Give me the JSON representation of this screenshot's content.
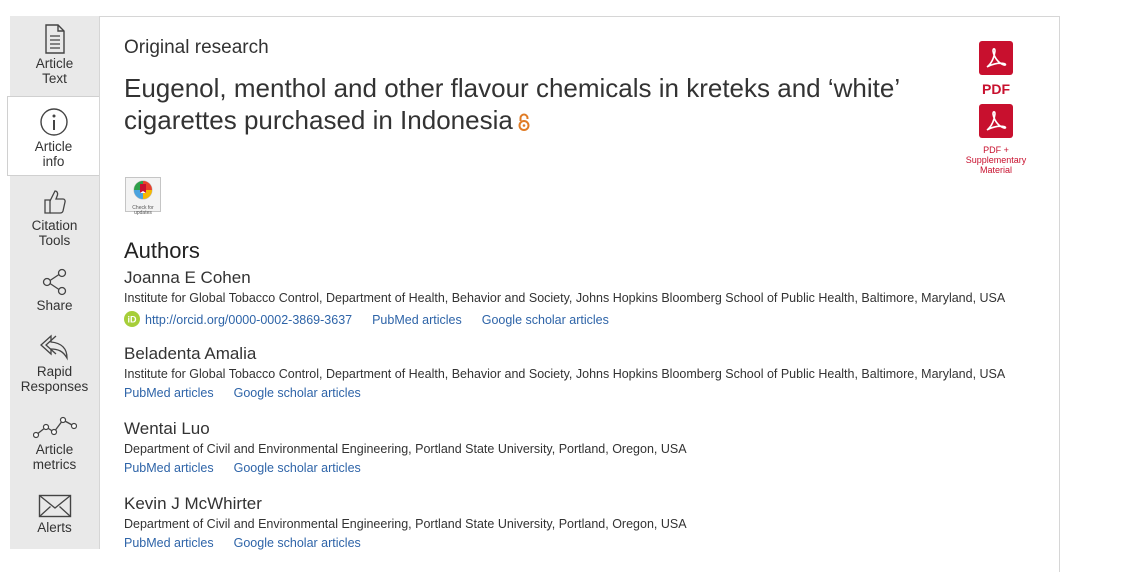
{
  "sidebar": {
    "items": [
      {
        "label_line1": "Article",
        "label_line2": "Text",
        "icon": "document-icon"
      },
      {
        "label_line1": "Article",
        "label_line2": "info",
        "icon": "info-icon",
        "active": true
      },
      {
        "label_line1": "Citation",
        "label_line2": "Tools",
        "icon": "thumbs-up-icon"
      },
      {
        "label_line1": "Share",
        "label_line2": "",
        "icon": "share-icon"
      },
      {
        "label_line1": "Rapid",
        "label_line2": "Responses",
        "icon": "reply-icon"
      },
      {
        "label_line1": "Article",
        "label_line2": "metrics",
        "icon": "line-chart-icon"
      },
      {
        "label_line1": "Alerts",
        "label_line2": "",
        "icon": "envelope-icon"
      }
    ]
  },
  "article": {
    "section": "Original research",
    "title": "Eugenol, menthol and other flavour chemicals in kreteks and ‘white’ cigarettes purchased in Indonesia",
    "open_access_icon": "open-access-lock-icon"
  },
  "downloads": {
    "pdf_label": "PDF",
    "pdf_supp_line1": "PDF +",
    "pdf_supp_line2": "Supplementary",
    "pdf_supp_line3": "Material"
  },
  "crossmark": {
    "line1": "Check for",
    "line2": "updates"
  },
  "authors": {
    "heading": "Authors",
    "list": [
      {
        "name": "Joanna E Cohen",
        "affiliation": "Institute for Global Tobacco Control, Department of Health, Behavior and Society, Johns Hopkins Bloomberg School of Public Health, Baltimore, Maryland, USA",
        "orcid": "http://orcid.org/0000-0002-3869-3637",
        "pubmed": "PubMed articles",
        "scholar": "Google scholar articles"
      },
      {
        "name": "Beladenta Amalia",
        "affiliation": "Institute for Global Tobacco Control, Department of Health, Behavior and Society, Johns Hopkins Bloomberg School of Public Health, Baltimore, Maryland, USA",
        "pubmed": "PubMed articles",
        "scholar": "Google scholar articles"
      },
      {
        "name": "Wentai Luo",
        "affiliation": "Department of Civil and Environmental Engineering, Portland State University, Portland, Oregon, USA",
        "pubmed": "PubMed articles",
        "scholar": "Google scholar articles"
      },
      {
        "name": "Kevin J McWhirter",
        "affiliation": "Department of Civil and Environmental Engineering, Portland State University, Portland, Oregon, USA",
        "pubmed": "PubMed articles",
        "scholar": "Google scholar articles"
      }
    ]
  },
  "colors": {
    "link": "#2e64a8",
    "pdf_red": "#c8102e",
    "orcid_green": "#a6ce39",
    "open_access": "#e07b24"
  }
}
